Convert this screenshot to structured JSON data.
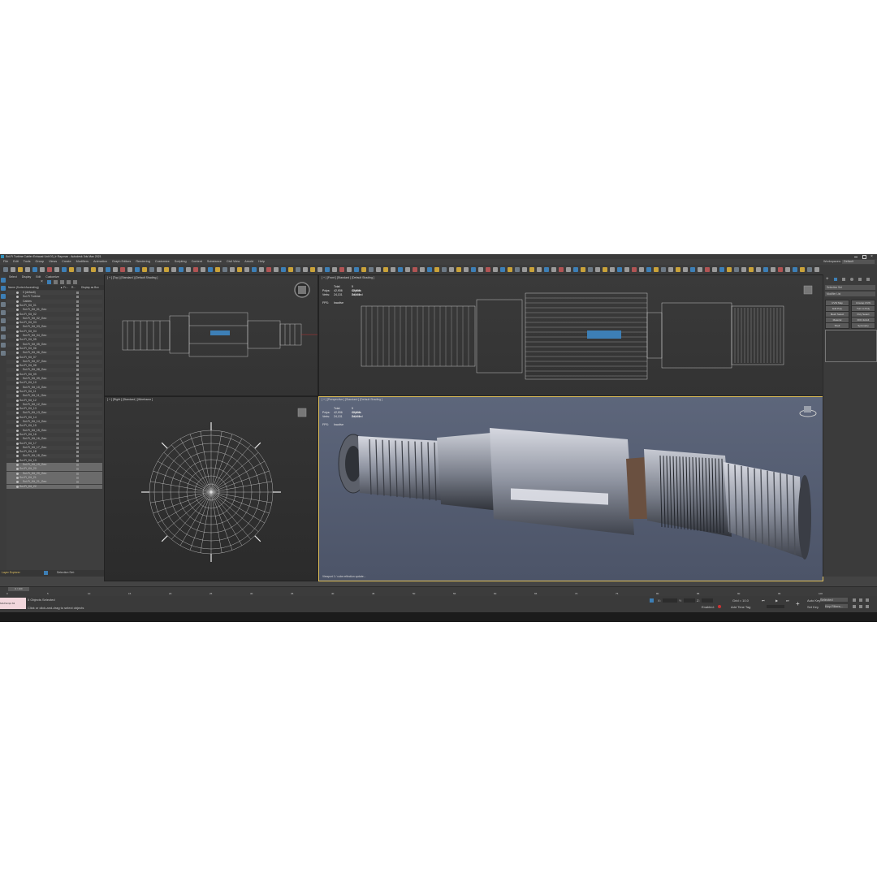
{
  "window": {
    "title": "Sci-Fi Turbine Cabler Exhaust Unit 03_Ir Ray.max - Autodesk 3ds Max 2021"
  },
  "menu": [
    "File",
    "Edit",
    "Tools",
    "Group",
    "Views",
    "Create",
    "Modifiers",
    "Animation",
    "Graph Editors",
    "Rendering",
    "Customize",
    "Scripting",
    "Content",
    "Substance",
    "Civil View",
    "Arnold",
    "Help"
  ],
  "workspace": {
    "label": "Workspaces:",
    "value": "Default"
  },
  "scene_explorer": {
    "tabs": [
      "Select",
      "Display",
      "Edit",
      "Customize"
    ],
    "header": {
      "name": "Name (Sorted Ascending)",
      "col1": "▲ Fr...",
      "col2": "R...",
      "col3": "Display as Box"
    },
    "rows": [
      "0 (default)",
      "Sci-Fi Turbine",
      "Cables",
      "Sci-Fi_Kit_01",
      "Sci-Fi_Kit_01_Geo",
      "Sci-Fi_Kit_02",
      "Sci-Fi_Kit_02_Geo",
      "Sci-Fi_Kit_03",
      "Sci-Fi_Kit_03_Geo",
      "Sci-Fi_Kit_04",
      "Sci-Fi_Kit_04_Geo",
      "Sci-Fi_Kit_05",
      "Sci-Fi_Kit_05_Geo",
      "Sci-Fi_Kit_06",
      "Sci-Fi_Kit_06_Geo",
      "Sci-Fi_Kit_07",
      "Sci-Fi_Kit_07_Geo",
      "Sci-Fi_Kit_08",
      "Sci-Fi_Kit_08_Geo",
      "Sci-Fi_Kit_09",
      "Sci-Fi_Kit_09_Geo",
      "Sci-Fi_Kit_10",
      "Sci-Fi_Kit_10_Geo",
      "Sci-Fi_Kit_11",
      "Sci-Fi_Kit_11_Geo",
      "Sci-Fi_Kit_12",
      "Sci-Fi_Kit_12_Geo",
      "Sci-Fi_Kit_13",
      "Sci-Fi_Kit_13_Geo",
      "Sci-Fi_Kit_14",
      "Sci-Fi_Kit_14_Geo",
      "Sci-Fi_Kit_15",
      "Sci-Fi_Kit_15_Geo",
      "Sci-Fi_Kit_16",
      "Sci-Fi_Kit_16_Geo",
      "Sci-Fi_Kit_17",
      "Sci-Fi_Kit_17_Geo",
      "Sci-Fi_Kit_18",
      "Sci-Fi_Kit_18_Geo",
      "Sci-Fi_Kit_19",
      "Sci-Fi_Kit_19_Geo",
      "Sci-Fi_Kit_20",
      "Sci-Fi_Kit_20_Geo",
      "Sci-Fi_Kit_21",
      "Sci-Fi_Kit_21_Geo",
      "Sci-Fi_Kit_22"
    ],
    "footer_left": "Layer Explorer",
    "footer_right": "Selection Set:"
  },
  "viewports": {
    "top": {
      "label": "[ + ] [Top ] [Standard ] [Default Shading ]"
    },
    "front": {
      "label": "[ + ] [Front ] [Standard ] [Default Shading ]",
      "stats": {
        "total": "Total",
        "selected": "5 Objects Selected",
        "polys_label": "Polys:",
        "polys_total": "42,936",
        "polys_sel": "42,936",
        "verts_label": "Verts:",
        "verts_total": "24,131",
        "verts_sel": "24,131",
        "fps_label": "FPS:",
        "fps_value": "Inactive"
      }
    },
    "right": {
      "label": "[ + ] [Right ] [Standard ] [Wireframe ]"
    },
    "perspective": {
      "label": "[ + ] [Perspective ] [Standard ] [Default Shading ]",
      "stats": {
        "total": "Total",
        "selected": "5 Objects Selected",
        "polys_label": "Polys:",
        "polys_total": "42,936",
        "polys_sel": "42,936",
        "verts_label": "Verts:",
        "verts_total": "24,131",
        "verts_sel": "24,131",
        "fps_label": "FPS:",
        "fps_value": "Inactive"
      },
      "bottom_note": "Viewport 1 / cube reflection update..."
    }
  },
  "command_panel": {
    "dropdown": "Selection Set",
    "modifier_list": "Modifier List",
    "buttons": [
      "UVW Map",
      "Unwrap UVW",
      "Edit Poly",
      "Turn to Poly",
      "Mesh Select",
      "Poly Select",
      "Material",
      "FFD 4x4x4",
      "Shell",
      "Symmetry"
    ]
  },
  "timeline": {
    "frame": "0 / 100",
    "ticks": [
      "0",
      "5",
      "10",
      "15",
      "20",
      "25",
      "30",
      "35",
      "40",
      "45",
      "50",
      "55",
      "60",
      "65",
      "70",
      "75",
      "80",
      "85",
      "90",
      "95",
      "100"
    ]
  },
  "status": {
    "selected": "5 Objects Selected",
    "hint": "Click or click-and-drag to select objects",
    "maxscript": "MAXScript Mi",
    "x": "X:",
    "y": "Y:",
    "z": "Z:",
    "grid": "Grid = 10.0",
    "auto": "Auto Key",
    "set": "Set Key",
    "selected_mode": "Selected",
    "key_filters": "Key Filters...",
    "add_time_tag": "Add Time Tag",
    "enabled": "Enabled:"
  },
  "colors": {
    "bg": "#444444",
    "accent": "#3d7fb6",
    "perspective_bg": "#5a6276",
    "ortho_bg": "#3e3e3e"
  }
}
